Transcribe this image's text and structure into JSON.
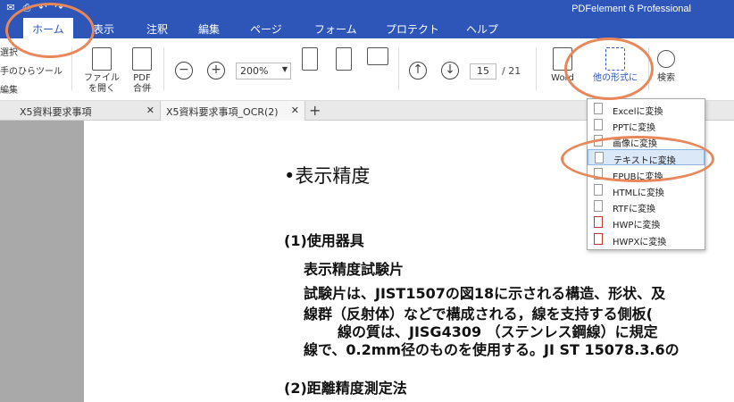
{
  "app": {
    "title": "PDFelement 6 Professional"
  },
  "menu": {
    "tabs": [
      {
        "label": "ホーム"
      },
      {
        "label": "表示"
      },
      {
        "label": "注釈"
      },
      {
        "label": "編集"
      },
      {
        "label": "ページ"
      },
      {
        "label": "フォーム"
      },
      {
        "label": "プロテクト"
      },
      {
        "label": "ヘルプ"
      }
    ]
  },
  "ribbon": {
    "side_tools": [
      "選択",
      "手のひらツール",
      "編集"
    ],
    "open_file": "ファイル\nを開く",
    "combine_pdf": "PDF\n合併",
    "zoom": "200%",
    "page_current": "15",
    "page_total": "/  21",
    "to_word": "Word",
    "to_other": "他の形式に",
    "search": "検索"
  },
  "tabs": [
    {
      "label": "X5資料要求事項"
    },
    {
      "label": "X5資料要求事項_OCR(2)"
    }
  ],
  "dropdown": {
    "items": [
      {
        "label": "Excelに変換"
      },
      {
        "label": "PPTに変換"
      },
      {
        "label": "画像に変換"
      },
      {
        "label": "テキストに変換"
      },
      {
        "label": "EPUBに変換"
      },
      {
        "label": "HTMLに変換"
      },
      {
        "label": "RTFに変換"
      },
      {
        "label": "HWPに変換"
      },
      {
        "label": "HWPXに変換"
      }
    ],
    "highlighted": "テキストに変換"
  },
  "document": {
    "heading": "•表示精度",
    "section1": "(1)使用器具",
    "subheading": "表示精度試験片",
    "lines": [
      "試験片は、JIST1507の図18に示される構造、形状、及",
      "線群（反射体）などで構成される，線を支持する側板(",
      "線の質は、JISG4309 （ステンレス鋼線）に規定",
      "線で、0.2mm径のものを使用する。JI ST 15078.3.6の"
    ],
    "section2": "(2)距離精度測定法"
  },
  "colors": {
    "brand_blue": "#2e55b8",
    "annotation_orange": "#e8875a",
    "highlight": "#dbe8f8"
  }
}
